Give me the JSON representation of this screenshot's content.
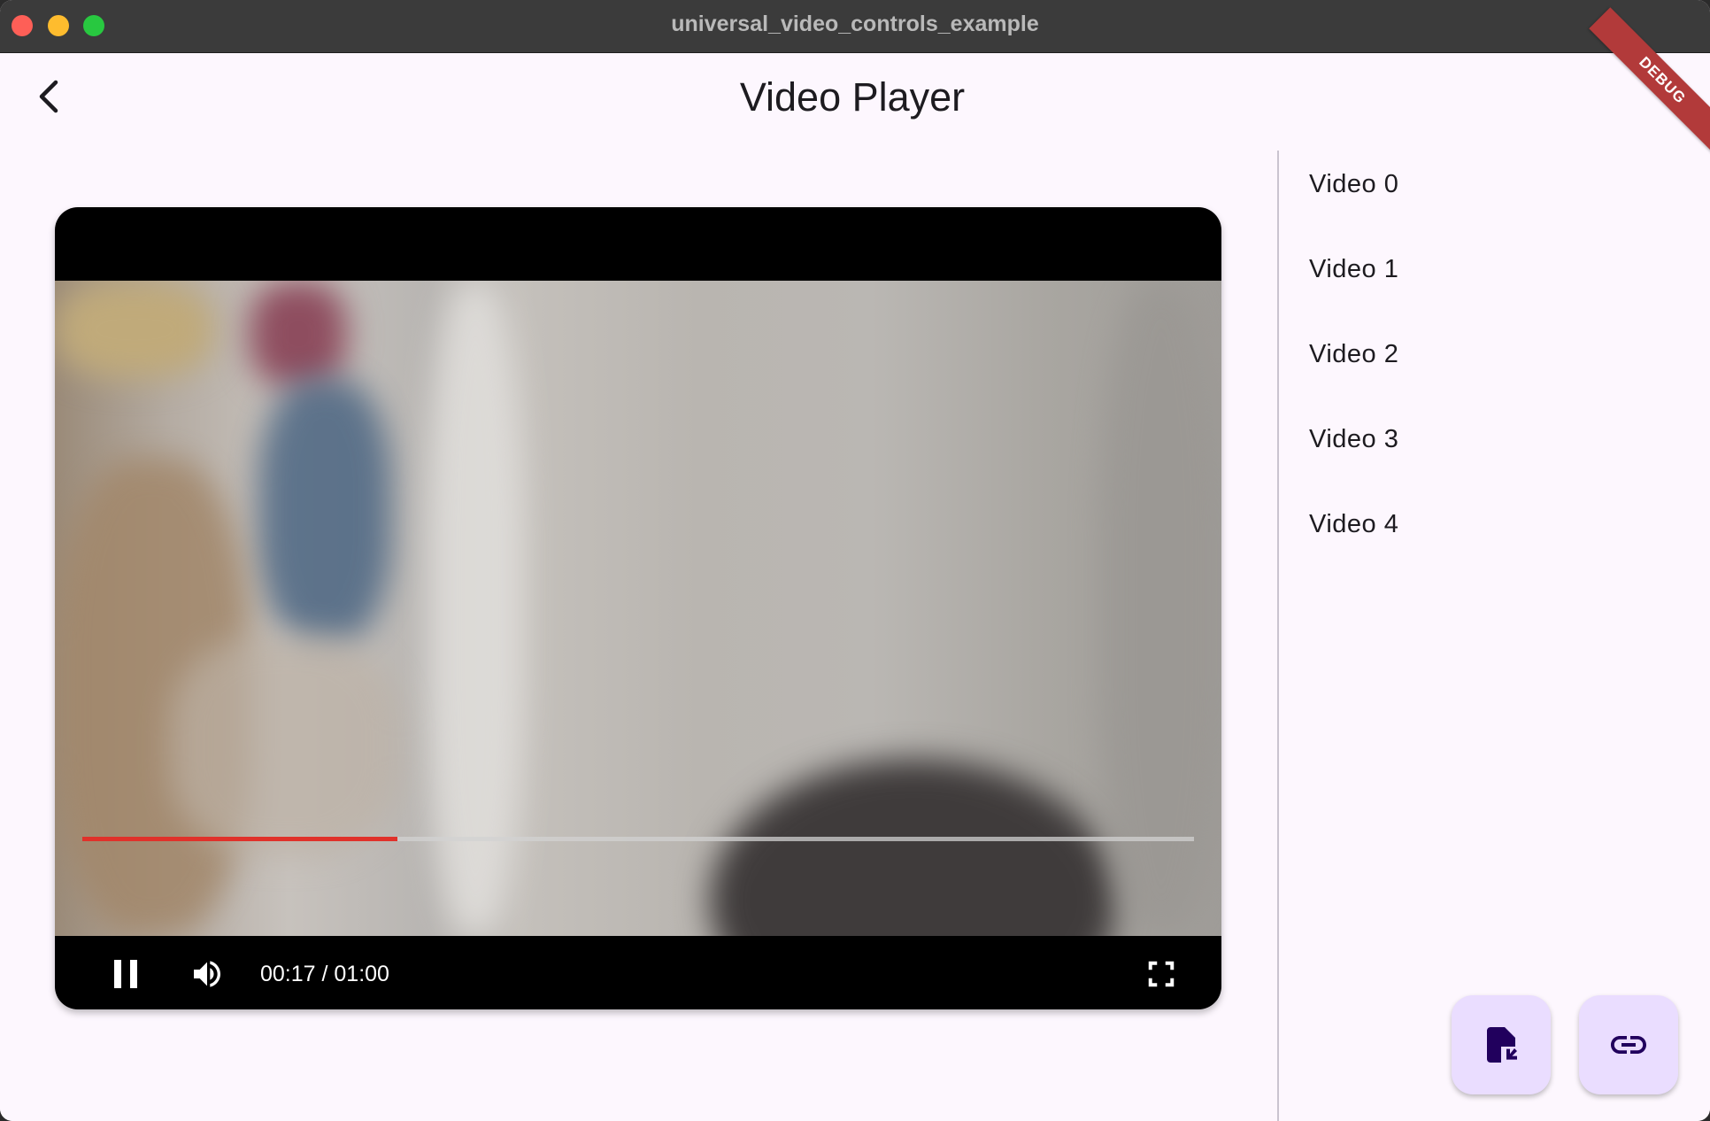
{
  "window": {
    "title": "universal_video_controls_example"
  },
  "app_bar": {
    "title": "Video Player",
    "back_icon": "chevron-left-icon"
  },
  "debug_banner": {
    "label": "DEBUG",
    "color": "#b23a3a"
  },
  "player": {
    "time_display": "00:17 / 01:00",
    "progress_fraction": 0.2833,
    "progress_color": "#e0312a",
    "pause_icon": "pause-icon",
    "volume_icon": "volume-up-icon",
    "fullscreen_icon": "fullscreen-icon"
  },
  "playlist": {
    "items": [
      {
        "label": "Video 0"
      },
      {
        "label": "Video 1"
      },
      {
        "label": "Video 2"
      },
      {
        "label": "Video 3"
      },
      {
        "label": "Video 4"
      }
    ]
  },
  "fabs": {
    "open_file_icon": "file-open-icon",
    "open_url_icon": "link-icon",
    "color": "#eaddff",
    "icon_color": "#21005d"
  }
}
